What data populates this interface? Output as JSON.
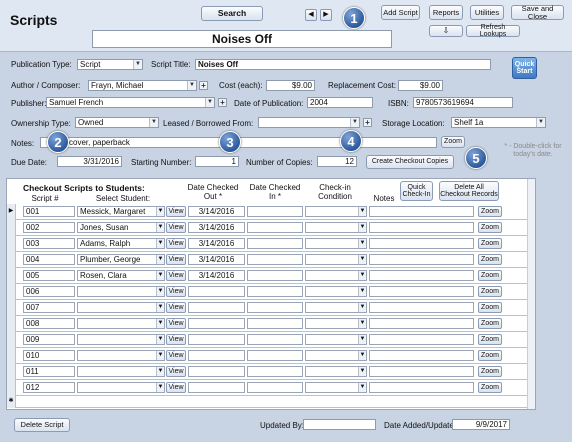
{
  "window": {
    "title": "Scripts"
  },
  "toolbar": {
    "search": "Search",
    "add_script": "Add Script",
    "reports": "Reports",
    "utilities": "Utilities",
    "save_close": "Save and Close",
    "refresh": "Refresh Lookups",
    "record_title": "Noises Off",
    "quick_start": "Quick Start"
  },
  "callouts": [
    "1",
    "2",
    "3",
    "4",
    "5"
  ],
  "form": {
    "publication_type_label": "Publication Type:",
    "publication_type": "Script",
    "script_title_label": "Script Title:",
    "script_title": "Noises Off",
    "author_label": "Author / Composer:",
    "author": "Frayn, Michael",
    "cost_label": "Cost (each):",
    "cost": "$9.00",
    "replacement_label": "Replacement Cost:",
    "replacement": "$9.00",
    "publisher_label": "Publisher:",
    "publisher": "Samuel French",
    "pub_date_label": "Date of Publication:",
    "pub_date": "2004",
    "isbn_label": "ISBN:",
    "isbn": "9780573619694",
    "ownership_label": "Ownership Type:",
    "ownership": "Owned",
    "leased_label": "Leased / Borrowed From:",
    "leased": "",
    "storage_label": "Storage Location:",
    "storage": "Shelf 1a",
    "notes_label": "Notes:",
    "notes": "cover, paperback",
    "zoom": "Zoom",
    "due_label": "Due Date:",
    "due": "3/31/2016",
    "starting_label": "Starting Number:",
    "starting": "1",
    "copies_label": "Number of Copies:",
    "copies": "12",
    "create_btn": "Create Checkout Copies",
    "hint": "* - Double-click for today's date."
  },
  "subform": {
    "title": "Checkout Scripts to Students:",
    "headers": {
      "script": "Script #",
      "student": "Select Student:",
      "date_out": "Date Checked Out *",
      "date_in": "Date Checked In *",
      "condition": "Check-in Condition",
      "notes": "Notes"
    },
    "quick_checkin": "Quick Check-In",
    "delete_all": "Delete All Checkout Records",
    "view": "View",
    "zoom": "Zoom",
    "rows": [
      {
        "num": "001",
        "student": "Messick, Margaret",
        "date": "3/14/2016"
      },
      {
        "num": "002",
        "student": "Jones, Susan",
        "date": "3/14/2016"
      },
      {
        "num": "003",
        "student": "Adams, Ralph",
        "date": "3/14/2016"
      },
      {
        "num": "004",
        "student": "Plumber, George",
        "date": "3/14/2016"
      },
      {
        "num": "005",
        "student": "Rosen, Clara",
        "date": "3/14/2016"
      },
      {
        "num": "006",
        "student": "",
        "date": ""
      },
      {
        "num": "007",
        "student": "",
        "date": ""
      },
      {
        "num": "008",
        "student": "",
        "date": ""
      },
      {
        "num": "009",
        "student": "",
        "date": ""
      },
      {
        "num": "010",
        "student": "",
        "date": ""
      },
      {
        "num": "011",
        "student": "",
        "date": ""
      },
      {
        "num": "012",
        "student": "",
        "date": ""
      }
    ]
  },
  "footer": {
    "delete": "Delete Script",
    "updated_by_label": "Updated By:",
    "updated_by": "",
    "date_added_label": "Date Added/Updated",
    "date_added": "9/9/2017"
  }
}
